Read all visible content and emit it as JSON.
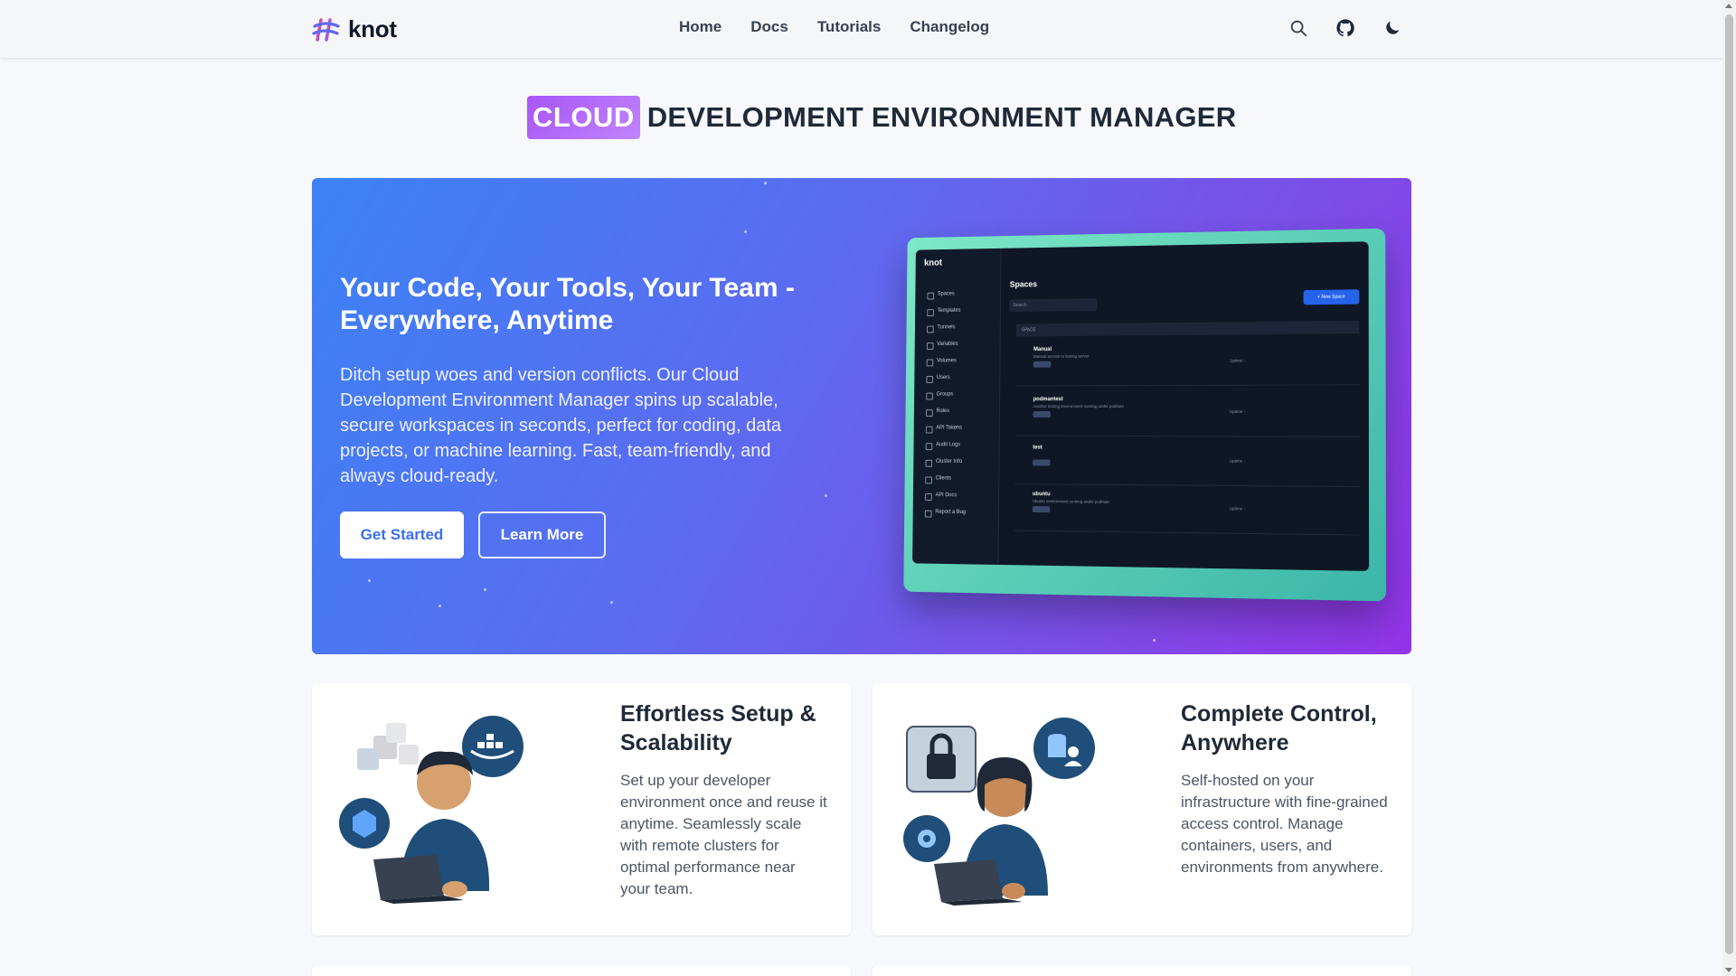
{
  "header": {
    "brand": "knot",
    "nav": [
      "Home",
      "Docs",
      "Tutorials",
      "Changelog"
    ],
    "icons": [
      "search-icon",
      "github-icon",
      "moon-icon"
    ]
  },
  "title": {
    "highlight": "CLOUD",
    "rest": "DEVELOPMENT ENVIRONMENT MANAGER"
  },
  "hero": {
    "heading": "Your Code, Your Tools, Your Team - Everywhere, Anytime",
    "description": "Ditch setup woes and version conflicts. Our Cloud Development Environment Manager spins up scalable, secure workspaces in seconds, perfect for coding, data projects, or machine learning. Fast, team-friendly, and always cloud-ready.",
    "primary_button": "Get Started",
    "secondary_button": "Learn More",
    "mock": {
      "logo": "knot",
      "nav": [
        "Spaces",
        "Templates",
        "Tunnels",
        "Variables",
        "Volumes",
        "Users",
        "Groups",
        "Roles",
        "API Tokens",
        "Audit Logs",
        "Cluster Info",
        "Clients",
        "API Docs",
        "Report a Bug"
      ],
      "heading": "Spaces",
      "search": "Search",
      "new_button": "+ New Space",
      "table_head": "SPACE",
      "rows": [
        {
          "name": "Manual",
          "desc": "Manual access to testing server",
          "status": "Uptime -"
        },
        {
          "name": "podmantest",
          "desc": "Another testing environment running under podman",
          "status": "Uptime -"
        },
        {
          "name": "test",
          "desc": "",
          "status": "Uptime -"
        },
        {
          "name": "ubuntu",
          "desc": "Ubuntu environment running under podman",
          "status": "Uptime -"
        }
      ]
    }
  },
  "features": [
    {
      "title": "Effortless Setup & Scalability",
      "text": "Set up your developer environment once and reuse it anytime. Seamlessly scale with remote clusters for optimal performance near your team."
    },
    {
      "title": "Complete Control, Anywhere",
      "text": "Self-hosted on your infrastructure with fine-grained access control. Manage containers, users, and environments from anywhere."
    }
  ],
  "colors": {
    "hero_start": "#3b82f6",
    "hero_end": "#9333ea",
    "highlight": "#a855f7"
  }
}
